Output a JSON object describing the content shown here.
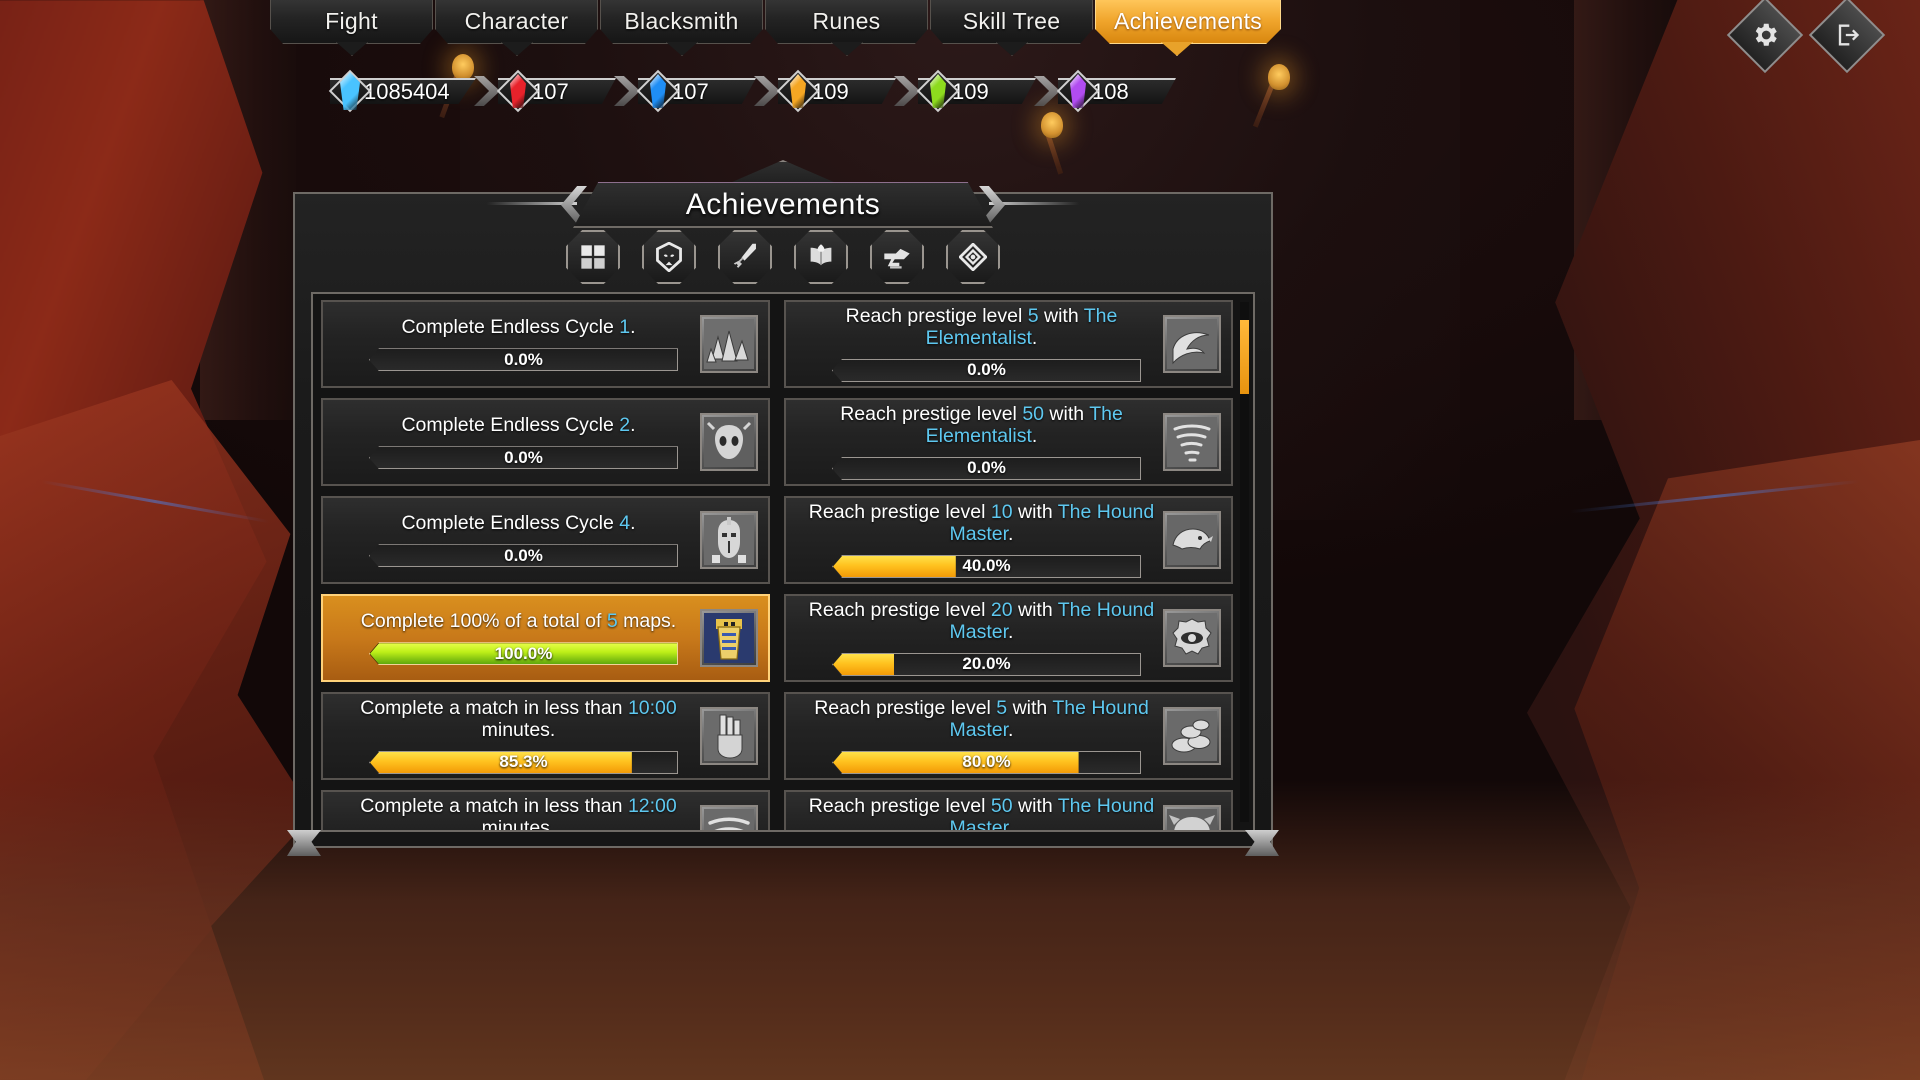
{
  "nav": {
    "tabs": [
      {
        "label": "Fight",
        "active": false
      },
      {
        "label": "Character",
        "active": false
      },
      {
        "label": "Blacksmith",
        "active": false
      },
      {
        "label": "Runes",
        "active": false
      },
      {
        "label": "Skill Tree",
        "active": false
      },
      {
        "label": "Achievements",
        "active": true
      }
    ],
    "settings_icon": "gear-icon",
    "exit_icon": "exit-door-icon"
  },
  "resources": [
    {
      "name": "crystal-blue-large",
      "value": "1085404",
      "color": "#49c3ff"
    },
    {
      "name": "gem-red",
      "value": "107",
      "color": "#e8222b"
    },
    {
      "name": "gem-blue",
      "value": "107",
      "color": "#1f8ef5"
    },
    {
      "name": "gem-orange",
      "value": "109",
      "color": "#f5a623"
    },
    {
      "name": "gem-green",
      "value": "109",
      "color": "#8ddb1e"
    },
    {
      "name": "gem-purple",
      "value": "108",
      "color": "#b14cf0"
    }
  ],
  "panel": {
    "title": "Achievements",
    "filters": [
      {
        "name": "filter-all",
        "icon": "grid-icon",
        "label": "All",
        "active": true
      },
      {
        "name": "filter-monsters",
        "icon": "mask-icon",
        "label": "",
        "active": false
      },
      {
        "name": "filter-combat",
        "icon": "sword-icon",
        "label": "",
        "active": false
      },
      {
        "name": "filter-spells",
        "icon": "spellbook-icon",
        "label": "",
        "active": false
      },
      {
        "name": "filter-crafting",
        "icon": "anvil-icon",
        "label": "",
        "active": false
      },
      {
        "name": "filter-gems",
        "icon": "diamond-icon",
        "label": "",
        "active": false
      }
    ],
    "scrollbar": {
      "position_pct": 4
    }
  },
  "achievements": [
    {
      "id": "endless-cycle-1",
      "text_parts": [
        {
          "t": "Complete Endless Cycle ",
          "hl": false
        },
        {
          "t": "1",
          "hl": true
        },
        {
          "t": ".",
          "hl": false
        }
      ],
      "progress": "0.0%",
      "progress_value": 0,
      "completed": false,
      "thumb": "spiked-rocks-icon"
    },
    {
      "id": "prestige-5-elementalist",
      "text_parts": [
        {
          "t": "Reach prestige level ",
          "hl": false
        },
        {
          "t": "5",
          "hl": true
        },
        {
          "t": " with ",
          "hl": false
        },
        {
          "t": "The Elementalist",
          "hl": true
        },
        {
          "t": ".",
          "hl": false
        }
      ],
      "progress": "0.0%",
      "progress_value": 0,
      "completed": false,
      "thumb": "horn-icon"
    },
    {
      "id": "endless-cycle-2",
      "text_parts": [
        {
          "t": "Complete Endless Cycle ",
          "hl": false
        },
        {
          "t": "2",
          "hl": true
        },
        {
          "t": ".",
          "hl": false
        }
      ],
      "progress": "0.0%",
      "progress_value": 0,
      "completed": false,
      "thumb": "goat-skull-icon"
    },
    {
      "id": "prestige-50-elementalist",
      "text_parts": [
        {
          "t": "Reach prestige level ",
          "hl": false
        },
        {
          "t": "50",
          "hl": true
        },
        {
          "t": " with ",
          "hl": false
        },
        {
          "t": "The Elementalist",
          "hl": true
        },
        {
          "t": ".",
          "hl": false
        }
      ],
      "progress": "0.0%",
      "progress_value": 0,
      "completed": false,
      "thumb": "tornado-icon"
    },
    {
      "id": "endless-cycle-4",
      "text_parts": [
        {
          "t": "Complete Endless Cycle ",
          "hl": false
        },
        {
          "t": "4",
          "hl": true
        },
        {
          "t": ".",
          "hl": false
        }
      ],
      "progress": "0.0%",
      "progress_value": 0,
      "completed": false,
      "thumb": "knight-icon"
    },
    {
      "id": "prestige-10-hound-master",
      "text_parts": [
        {
          "t": "Reach prestige level ",
          "hl": false
        },
        {
          "t": "10",
          "hl": true
        },
        {
          "t": " with ",
          "hl": false
        },
        {
          "t": "The Hound Master",
          "hl": true
        },
        {
          "t": ".",
          "hl": false
        }
      ],
      "progress": "40.0%",
      "progress_value": 40,
      "completed": false,
      "thumb": "hound-icon"
    },
    {
      "id": "complete-100-5-maps",
      "text_parts": [
        {
          "t": "Complete 100% of a total of ",
          "hl": false
        },
        {
          "t": "5",
          "hl": true
        },
        {
          "t": " maps.",
          "hl": false
        }
      ],
      "progress": "100.0%",
      "progress_value": 100,
      "completed": true,
      "thumb": "mummy-icon"
    },
    {
      "id": "prestige-20-hound-master",
      "text_parts": [
        {
          "t": "Reach prestige level ",
          "hl": false
        },
        {
          "t": "20",
          "hl": true
        },
        {
          "t": " with ",
          "hl": false
        },
        {
          "t": "The Hound Master",
          "hl": true
        },
        {
          "t": ".",
          "hl": false
        }
      ],
      "progress": "20.0%",
      "progress_value": 20,
      "completed": false,
      "thumb": "gear-eye-icon"
    },
    {
      "id": "match-under-10-min",
      "text_parts": [
        {
          "t": "Complete a match in less than ",
          "hl": false
        },
        {
          "t": "10:00",
          "hl": true
        },
        {
          "t": " minutes.",
          "hl": false
        }
      ],
      "progress": "85.3%",
      "progress_value": 85.3,
      "completed": false,
      "thumb": "gauntlet-icon"
    },
    {
      "id": "prestige-5-hound-master",
      "text_parts": [
        {
          "t": "Reach prestige level ",
          "hl": false
        },
        {
          "t": "5",
          "hl": true
        },
        {
          "t": " with ",
          "hl": false
        },
        {
          "t": "The Hound Master",
          "hl": true
        },
        {
          "t": ".",
          "hl": false
        }
      ],
      "progress": "80.0%",
      "progress_value": 80,
      "completed": false,
      "thumb": "coins-icon"
    },
    {
      "id": "match-under-12-min",
      "text_parts": [
        {
          "t": "Complete a match in less than ",
          "hl": false
        },
        {
          "t": "12:00",
          "hl": true
        },
        {
          "t": " minutes.",
          "hl": false
        }
      ],
      "progress": "",
      "progress_value": 0,
      "completed": false,
      "thumb": "whirl-icon"
    },
    {
      "id": "prestige-50-hound-master",
      "text_parts": [
        {
          "t": "Reach prestige level ",
          "hl": false
        },
        {
          "t": "50",
          "hl": true
        },
        {
          "t": " with ",
          "hl": false
        },
        {
          "t": "The Hound Master",
          "hl": true
        },
        {
          "t": ".",
          "hl": false
        }
      ],
      "progress": "",
      "progress_value": 0,
      "completed": false,
      "thumb": "beast-head-icon"
    }
  ],
  "colors": {
    "accent_gold": "#e8a22a",
    "highlight_blue": "#5ec8f0",
    "bar_yellow": "#ffc21f",
    "bar_green": "#bff019"
  }
}
